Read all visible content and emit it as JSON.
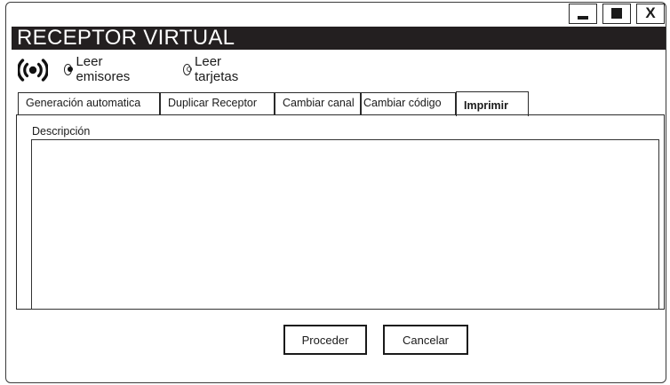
{
  "window": {
    "title": "RECEPTOR VIRTUAL",
    "controls": {
      "minimize_icon": "minimize-icon",
      "maximize_icon": "maximize-icon",
      "close_label": "X"
    }
  },
  "modes": {
    "icon": "signal-broadcast-icon",
    "options": [
      {
        "label": "Leer emisores",
        "selected": true
      },
      {
        "label": "Leer tarjetas",
        "selected": false
      }
    ]
  },
  "tabs": [
    {
      "label": "Generación automatica",
      "active": false
    },
    {
      "label": "Duplicar Receptor",
      "active": false
    },
    {
      "label": "Cambiar  canal",
      "active": false
    },
    {
      "label": "Cambiar código",
      "active": false
    },
    {
      "label": "Imprimir",
      "active": true
    }
  ],
  "panel": {
    "description_label": "Descripción",
    "description_value": ""
  },
  "actions": {
    "proceed_label": "Proceder",
    "cancel_label": "Cancelar"
  },
  "colors": {
    "titlebar_bg": "#231f20",
    "titlebar_text": "#ffffff",
    "border": "#2a2a2a"
  }
}
